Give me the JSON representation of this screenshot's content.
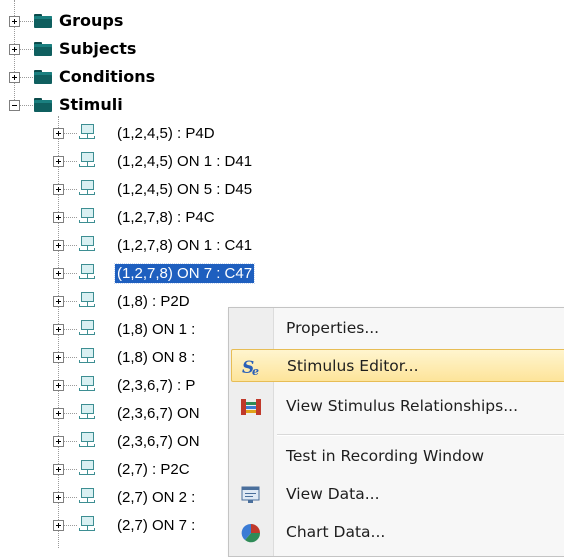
{
  "folders": [
    {
      "label": "Groups",
      "expanded": false
    },
    {
      "label": "Subjects",
      "expanded": false
    },
    {
      "label": "Conditions",
      "expanded": false
    },
    {
      "label": "Stimuli",
      "expanded": true
    }
  ],
  "stimuli": [
    {
      "label": "(1,2,4,5) : P4D",
      "selected": false
    },
    {
      "label": "(1,2,4,5) ON 1 : D41",
      "selected": false
    },
    {
      "label": "(1,2,4,5) ON 5 : D45",
      "selected": false
    },
    {
      "label": "(1,2,7,8) : P4C",
      "selected": false
    },
    {
      "label": "(1,2,7,8) ON 1 : C41",
      "selected": false
    },
    {
      "label": "(1,2,7,8) ON 7 : C47",
      "selected": true
    },
    {
      "label": "(1,8) : P2D",
      "selected": false
    },
    {
      "label": "(1,8) ON 1 :",
      "selected": false
    },
    {
      "label": "(1,8) ON 8 :",
      "selected": false
    },
    {
      "label": "(2,3,6,7) : P",
      "selected": false
    },
    {
      "label": "(2,3,6,7) ON",
      "selected": false
    },
    {
      "label": "(2,3,6,7) ON",
      "selected": false
    },
    {
      "label": "(2,7) : P2C",
      "selected": false
    },
    {
      "label": "(2,7) ON 2 :",
      "selected": false
    },
    {
      "label": "(2,7) ON 7 :",
      "selected": false
    }
  ],
  "context_menu": {
    "items": [
      {
        "label": "Properties...",
        "icon": "none",
        "highlighted": false
      },
      {
        "label": "Stimulus Editor...",
        "icon": "stimulus-editor-icon",
        "highlighted": true
      },
      {
        "label": "View Stimulus Relationships...",
        "icon": "relationships-icon",
        "highlighted": false
      },
      {
        "label": "Test in Recording Window",
        "icon": "none",
        "highlighted": false
      },
      {
        "label": "View Data...",
        "icon": "view-data-icon",
        "highlighted": false
      },
      {
        "label": "Chart Data...",
        "icon": "chart-data-icon",
        "highlighted": false
      }
    ]
  },
  "colors": {
    "selection": "#1e5fbf",
    "folder": "#0f5f5f",
    "menu_highlight": "#fde49a",
    "node_icon": "#3d8e92"
  }
}
